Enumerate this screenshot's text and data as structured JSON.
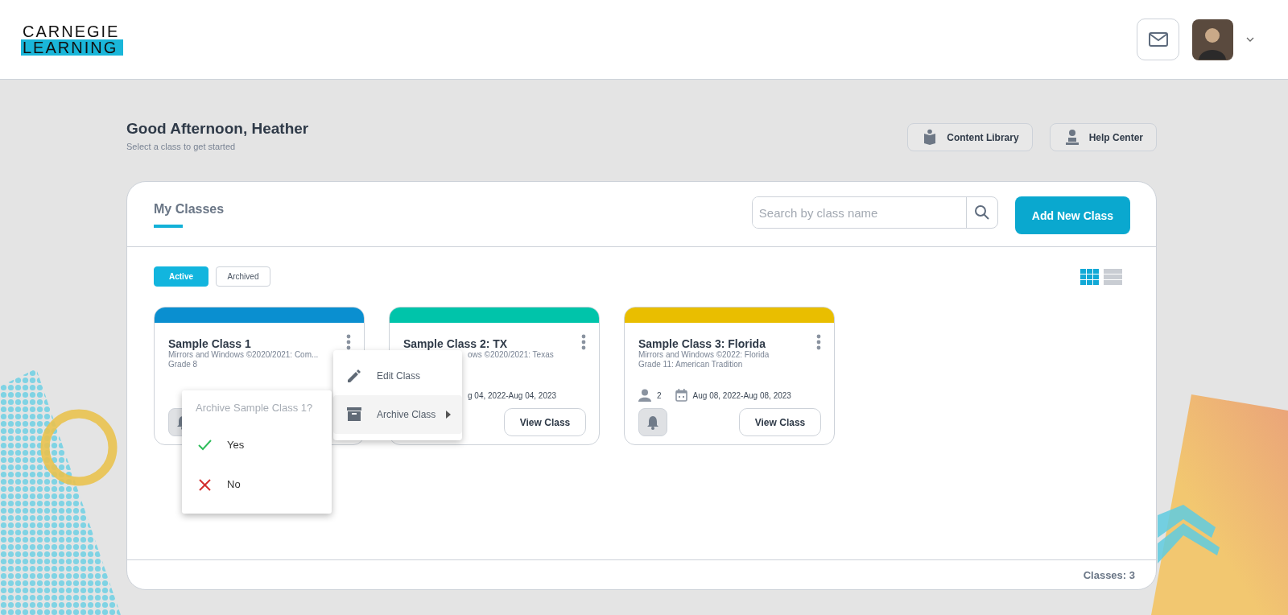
{
  "header": {
    "logo_top": "CARNEGIE",
    "logo_bottom": "LEARNING"
  },
  "greeting": {
    "title": "Good Afternoon, Heather",
    "subtitle": "Select a class to get started"
  },
  "top_buttons": [
    {
      "kind": "library",
      "label": "Content Library"
    },
    {
      "kind": "help",
      "label": "Help Center"
    }
  ],
  "panel": {
    "title": "My Classes",
    "search": {
      "placeholder": "Search by class name"
    },
    "add_button": "Add New Class",
    "filters": [
      {
        "label": "Active",
        "selected": true
      },
      {
        "label": "Archived",
        "selected": false
      }
    ],
    "view_modes": [
      {
        "kind": "grid",
        "selected": true
      },
      {
        "kind": "list",
        "selected": false
      }
    ],
    "cards": [
      {
        "title": "Sample Class 1",
        "color": "#0a8fd0",
        "lines": [
          "Mirrors and Windows ©2020/2021: Com...",
          "Grade 8"
        ],
        "covered": false,
        "bell": true
      },
      {
        "title": "Sample Class 2: TX",
        "color": "#00c4aa",
        "lines": [
          "ows ©2020/2021: Texas"
        ],
        "covered": true,
        "dates": "g 04, 2022-Aug 04, 2023",
        "view_button": "View Class"
      },
      {
        "title": "Sample Class 3: Florida",
        "color": "#e9be00",
        "lines": [
          "Mirrors and Windows ©2022: Florida",
          "Grade 11: American Tradition"
        ],
        "covered": false,
        "students": "2",
        "dates": "Aug 08, 2022-Aug 08, 2023",
        "bell": true,
        "view_button": "View Class"
      }
    ],
    "context_menu": [
      {
        "kind": "edit",
        "label": "Edit Class",
        "selected": false,
        "submenu": false
      },
      {
        "kind": "archive",
        "label": "Archive Class",
        "selected": true,
        "submenu": true
      }
    ],
    "confirm": {
      "title": "Archive Sample Class 1?",
      "options": [
        {
          "kind": "yes",
          "label": "Yes"
        },
        {
          "kind": "no",
          "label": "No"
        }
      ]
    },
    "footer": "Classes: 3"
  }
}
